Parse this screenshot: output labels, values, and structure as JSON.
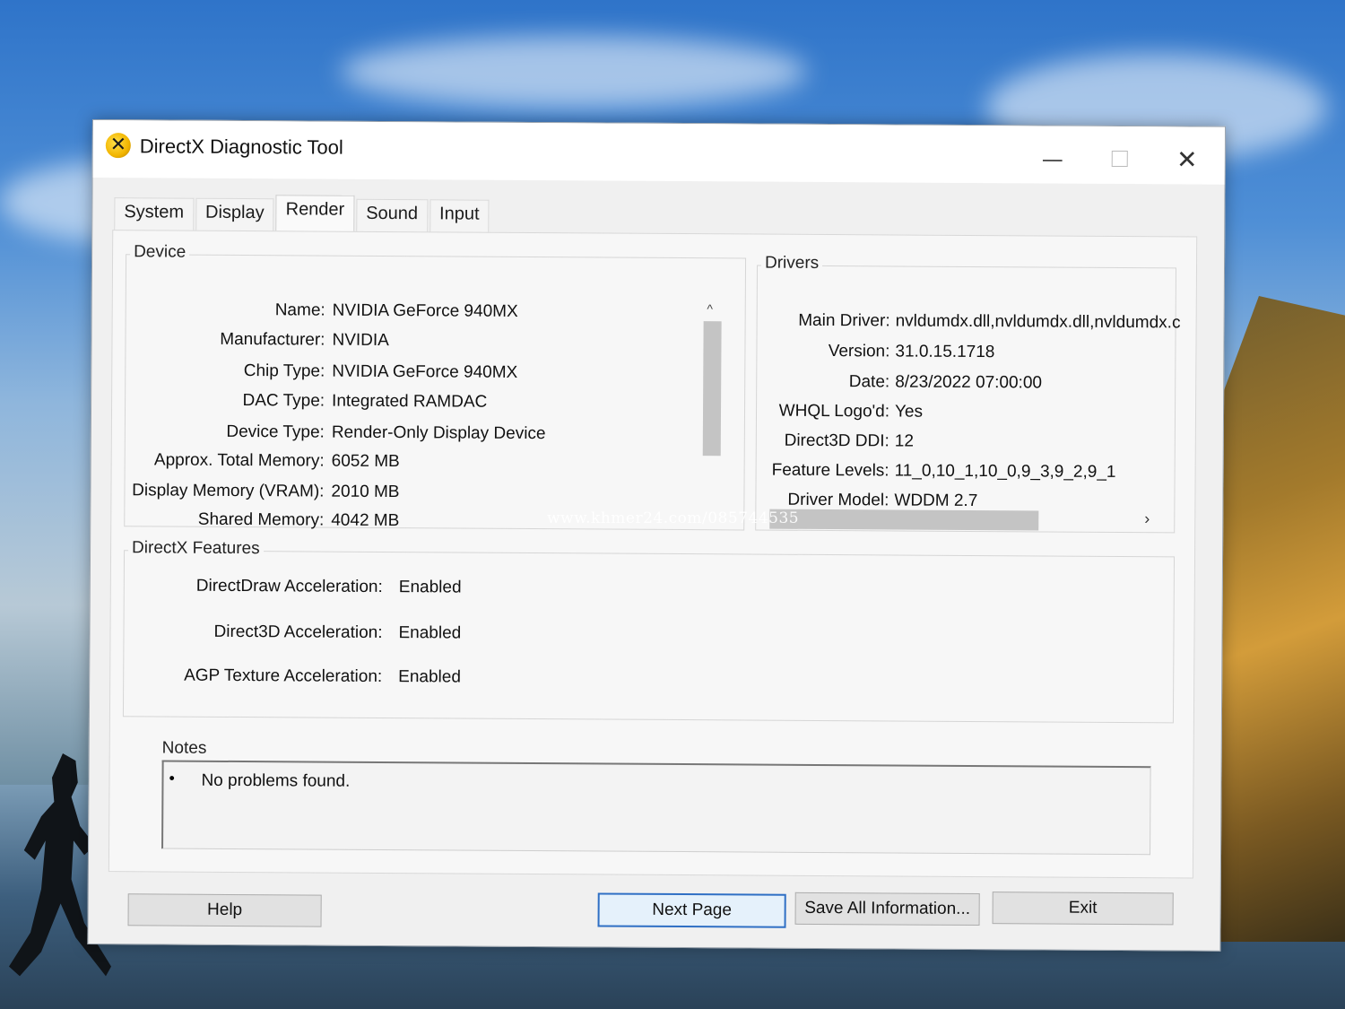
{
  "window": {
    "title": "DirectX Diagnostic Tool",
    "icon_glyph": "✕",
    "controls": {
      "minimize": "—",
      "close": "✕"
    }
  },
  "tabs": [
    {
      "label": "System",
      "active": false
    },
    {
      "label": "Display",
      "active": false
    },
    {
      "label": "Render",
      "active": true
    },
    {
      "label": "Sound",
      "active": false
    },
    {
      "label": "Input",
      "active": false
    }
  ],
  "device": {
    "heading": "Device",
    "fields": [
      {
        "label": "Name:",
        "value": "NVIDIA GeForce 940MX"
      },
      {
        "label": "Manufacturer:",
        "value": "NVIDIA"
      },
      {
        "label": "Chip Type:",
        "value": "NVIDIA GeForce 940MX"
      },
      {
        "label": "DAC Type:",
        "value": "Integrated RAMDAC"
      },
      {
        "label": "Device Type:",
        "value": "Render-Only Display Device"
      },
      {
        "label": "Approx. Total Memory:",
        "value": "6052 MB"
      },
      {
        "label": "Display Memory (VRAM):",
        "value": "2010 MB"
      },
      {
        "label": "Shared Memory:",
        "value": "4042 MB"
      }
    ]
  },
  "drivers": {
    "heading": "Drivers",
    "fields": [
      {
        "label": "Main Driver:",
        "value": "nvldumdx.dll,nvldumdx.dll,nvldumdx.c"
      },
      {
        "label": "Version:",
        "value": "31.0.15.1718"
      },
      {
        "label": "Date:",
        "value": "8/23/2022 07:00:00"
      },
      {
        "label": "WHQL Logo'd:",
        "value": "Yes"
      },
      {
        "label": "Direct3D DDI:",
        "value": "12"
      },
      {
        "label": "Feature Levels:",
        "value": "11_0,10_1,10_0,9_3,9_2,9_1"
      },
      {
        "label": "Driver Model:",
        "value": "WDDM 2.7"
      }
    ]
  },
  "features": {
    "heading": "DirectX Features",
    "fields": [
      {
        "label": "DirectDraw Acceleration:",
        "value": "Enabled"
      },
      {
        "label": "Direct3D Acceleration:",
        "value": "Enabled"
      },
      {
        "label": "AGP Texture Acceleration:",
        "value": "Enabled"
      }
    ]
  },
  "notes": {
    "heading": "Notes",
    "bullet": "•",
    "items": [
      "No problems found."
    ]
  },
  "buttons": {
    "help": "Help",
    "next_page": "Next Page",
    "save_all": "Save All Information...",
    "exit": "Exit"
  },
  "scroll_glyphs": {
    "up": "^",
    "right": "›"
  },
  "watermark": "www.khmer24.com/085744535"
}
